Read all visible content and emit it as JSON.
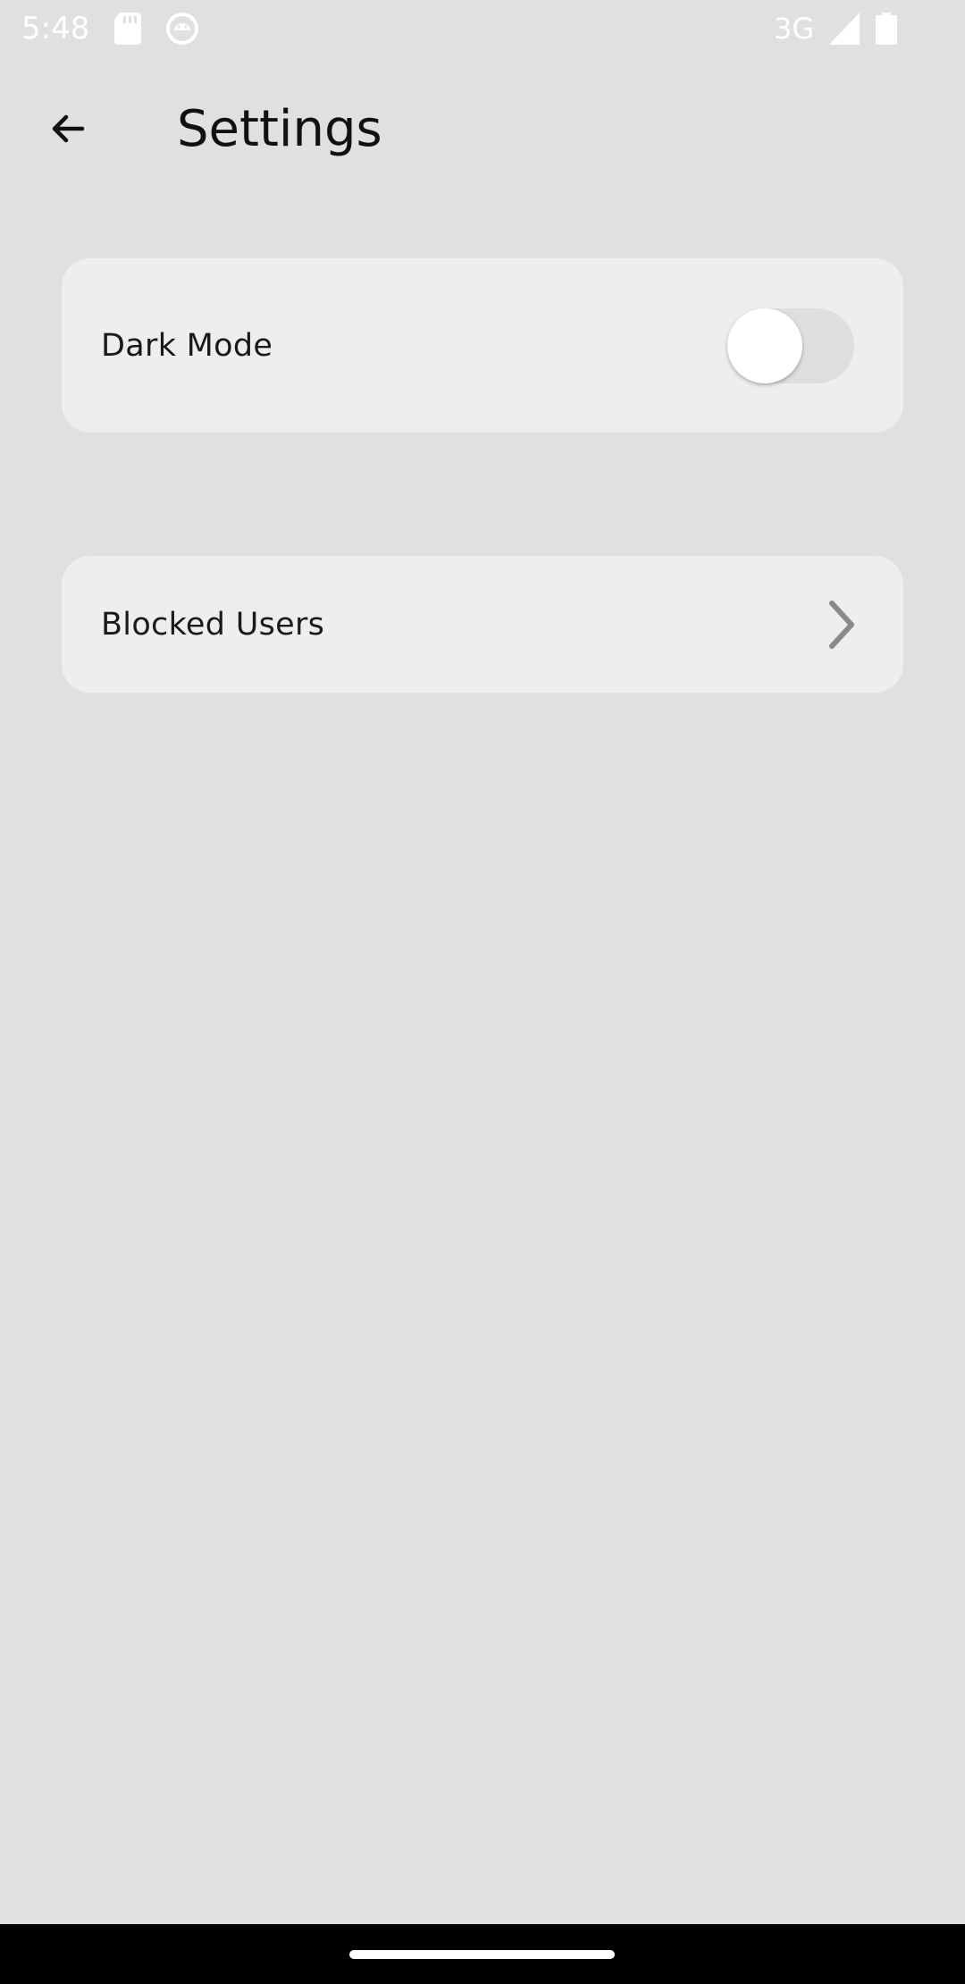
{
  "status_bar": {
    "time": "5:48",
    "network": "3G",
    "icons": [
      "sd-card-icon",
      "android-debug-icon",
      "signal-icon",
      "battery-icon"
    ]
  },
  "app_bar": {
    "title": "Settings",
    "back_icon": "arrow-left-icon"
  },
  "settings": {
    "dark_mode": {
      "label": "Dark Mode",
      "enabled": false
    },
    "blocked_users": {
      "label": "Blocked Users",
      "icon": "chevron-right-icon"
    }
  },
  "colors": {
    "background": "#e0e0e0",
    "card": "#eeeeee",
    "text": "#111111",
    "toggle_track_off": "#dedede",
    "toggle_thumb": "#ffffff",
    "chevron": "#8a8a8a"
  }
}
